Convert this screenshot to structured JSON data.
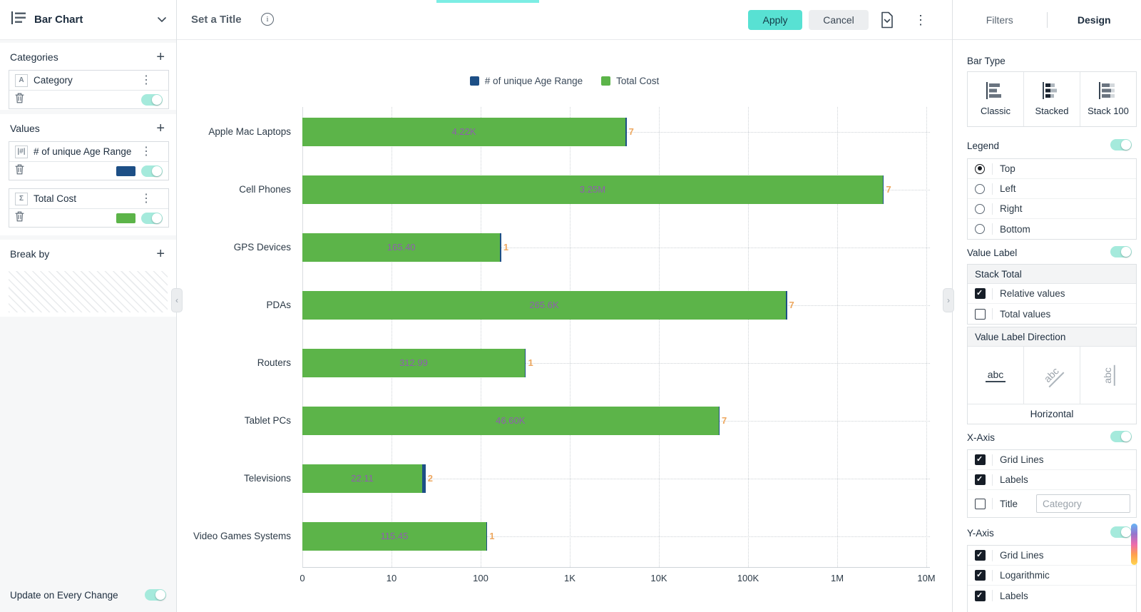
{
  "window": {
    "top_strip_color": "#7CEDE4"
  },
  "sidebar": {
    "chart_selector": {
      "label": "Bar Chart"
    },
    "categories": {
      "title": "Categories",
      "item": {
        "icon": "A",
        "label": "Category",
        "enabled": true
      }
    },
    "values": {
      "title": "Values",
      "items": [
        {
          "icon": "|#|",
          "label": "# of unique Age Range",
          "swatch": "#1D4F86",
          "enabled": true
        },
        {
          "icon": "Σ",
          "label": "Total Cost",
          "swatch": "#5CB449",
          "enabled": true
        }
      ]
    },
    "break_by": {
      "title": "Break by"
    },
    "footer": {
      "label": "Update on Every Change",
      "enabled": true
    }
  },
  "toolbar": {
    "title_label": "Set a Title",
    "apply": "Apply",
    "cancel": "Cancel"
  },
  "chart_data": {
    "type": "bar",
    "orientation": "horizontal",
    "stacked": true,
    "categories": [
      "Apple Mac Laptops",
      "Cell Phones",
      "GPS Devices",
      "PDAs",
      "Routers",
      "Tablet PCs",
      "Televisions",
      "Video Games Systems"
    ],
    "series": [
      {
        "name": "# of unique Age Range",
        "color": "#1D4F86",
        "values": [
          7,
          7,
          1,
          7,
          1,
          7,
          2,
          1
        ],
        "labels": [
          "7",
          "7",
          "1",
          "7",
          "1",
          "7",
          "2",
          "1"
        ],
        "label_color": "#EDA75F"
      },
      {
        "name": "Total Cost",
        "color": "#5CB449",
        "values": [
          4220,
          3250000,
          165.4,
          265600,
          312.99,
          46600,
          22.11,
          115.45
        ],
        "labels": [
          "4.22K",
          "3.25M",
          "165.40",
          "265.6K",
          "312.99",
          "46.60K",
          "22.11",
          "115.45"
        ],
        "label_color": "#8F5FAE"
      }
    ],
    "legend": {
      "position": "top",
      "items": [
        {
          "label": "# of unique Age Range",
          "color": "#1D4F86"
        },
        {
          "label": "Total Cost",
          "color": "#5CB449"
        }
      ]
    },
    "x_axis": {
      "logarithmic": true,
      "grid": true,
      "ticks": [
        "0",
        "10",
        "100",
        "1K",
        "10K",
        "100K",
        "1M",
        "10M"
      ]
    }
  },
  "design": {
    "tabs": {
      "filters": "Filters",
      "design": "Design",
      "active": "Design"
    },
    "bar_type": {
      "title": "Bar Type",
      "options": [
        "Classic",
        "Stacked",
        "Stack 100"
      ]
    },
    "legend": {
      "title": "Legend",
      "enabled": true,
      "options": [
        {
          "label": "Top",
          "selected": true
        },
        {
          "label": "Left",
          "selected": false
        },
        {
          "label": "Right",
          "selected": false
        },
        {
          "label": "Bottom",
          "selected": false
        }
      ]
    },
    "value_label": {
      "title": "Value Label",
      "enabled": true
    },
    "stack_total": {
      "title": "Stack Total",
      "options": [
        {
          "label": "Relative values",
          "checked": true
        },
        {
          "label": "Total values",
          "checked": false
        }
      ]
    },
    "value_label_direction": {
      "title": "Value Label Direction",
      "selected": "Horizontal",
      "caption": "Horizontal"
    },
    "x_axis": {
      "title": "X-Axis",
      "enabled": true,
      "title_value": "Category",
      "options": [
        {
          "label": "Grid Lines",
          "checked": true
        },
        {
          "label": "Labels",
          "checked": true
        },
        {
          "label": "Title",
          "checked": false
        }
      ]
    },
    "y_axis": {
      "title": "Y-Axis",
      "enabled": true,
      "options": [
        {
          "label": "Grid Lines",
          "checked": true
        },
        {
          "label": "Logarithmic",
          "checked": true
        },
        {
          "label": "Labels",
          "checked": true
        }
      ]
    }
  }
}
